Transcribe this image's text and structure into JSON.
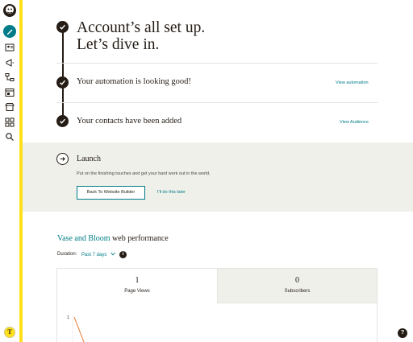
{
  "nav": {
    "items": [
      {
        "icon": "pencil-icon",
        "name": "create"
      },
      {
        "icon": "audience-icon",
        "name": "audience"
      },
      {
        "icon": "megaphone-icon",
        "name": "campaigns"
      },
      {
        "icon": "automations-icon",
        "name": "automations"
      },
      {
        "icon": "website-icon",
        "name": "website"
      },
      {
        "icon": "store-icon",
        "name": "content-studio"
      },
      {
        "icon": "grid-icon",
        "name": "integrations"
      },
      {
        "icon": "search-icon",
        "name": "search"
      }
    ],
    "avatar_initial": "T",
    "accent_color": "#ffe01b",
    "create_color": "#007c89"
  },
  "onboarding": {
    "headline_line1": "Account’s all set up.",
    "headline_line2": "Let’s dive in.",
    "steps": [
      {
        "title": "Your automation is looking good!",
        "link": "View automation",
        "status": "complete"
      },
      {
        "title": "Your contacts have been added",
        "link": "View Audience",
        "status": "complete"
      }
    ],
    "launch": {
      "title": "Launch",
      "description": "Put on the finishing touches and get your hard work out in the world.",
      "primary_button": "Back To Website Builder",
      "secondary_link": "I'll do this later"
    }
  },
  "performance": {
    "site_name": "Vase and Bloom",
    "title_suffix": " web performance",
    "duration_label": "Duration:",
    "duration_value": "Past 7 days",
    "info_icon_text": "i",
    "stats": [
      {
        "value": "1",
        "label": "Page Views",
        "active": true
      },
      {
        "value": "0",
        "label": "Subscribers",
        "active": false
      }
    ],
    "chart_ytick": "1"
  },
  "help": {
    "label": "?"
  }
}
